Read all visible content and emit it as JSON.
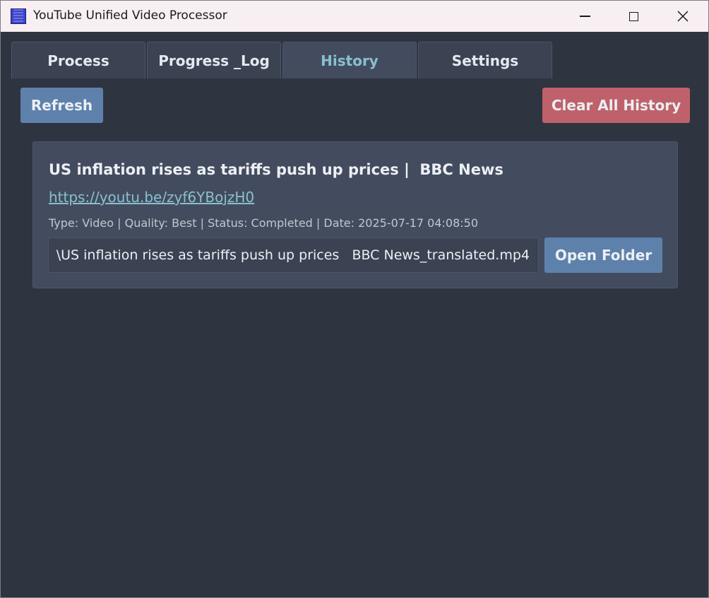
{
  "window": {
    "title": "YouTube Unified Video Processor",
    "icon": "app-video-icon",
    "controls": [
      "minimize-icon",
      "maximize-icon",
      "close-icon"
    ]
  },
  "tabs": [
    {
      "label": "Process",
      "active": false
    },
    {
      "label": "Progress _Log",
      "active": false
    },
    {
      "label": "History",
      "active": true
    },
    {
      "label": "Settings",
      "active": false
    }
  ],
  "toolbar": {
    "refresh_label": "Refresh",
    "clear_label": "Clear All History"
  },
  "history": [
    {
      "title": "US inflation rises as tariffs push up prices |  BBC News",
      "url": "https://youtu.be/zyf6YBojzH0",
      "meta": "Type: Video | Quality: Best | Status: Completed | Date: 2025-07-17 04:08:50",
      "path": "\\US inflation rises as tariffs push up prices   BBC News_translated.mp4",
      "open_folder_label": "Open Folder"
    }
  ],
  "colors": {
    "background": "#2e3440",
    "card": "#434c5e",
    "accent_button": "#5e81ac",
    "danger_button": "#bf616a",
    "link": "#88c0d0",
    "titlebar": "#f8eff3"
  }
}
